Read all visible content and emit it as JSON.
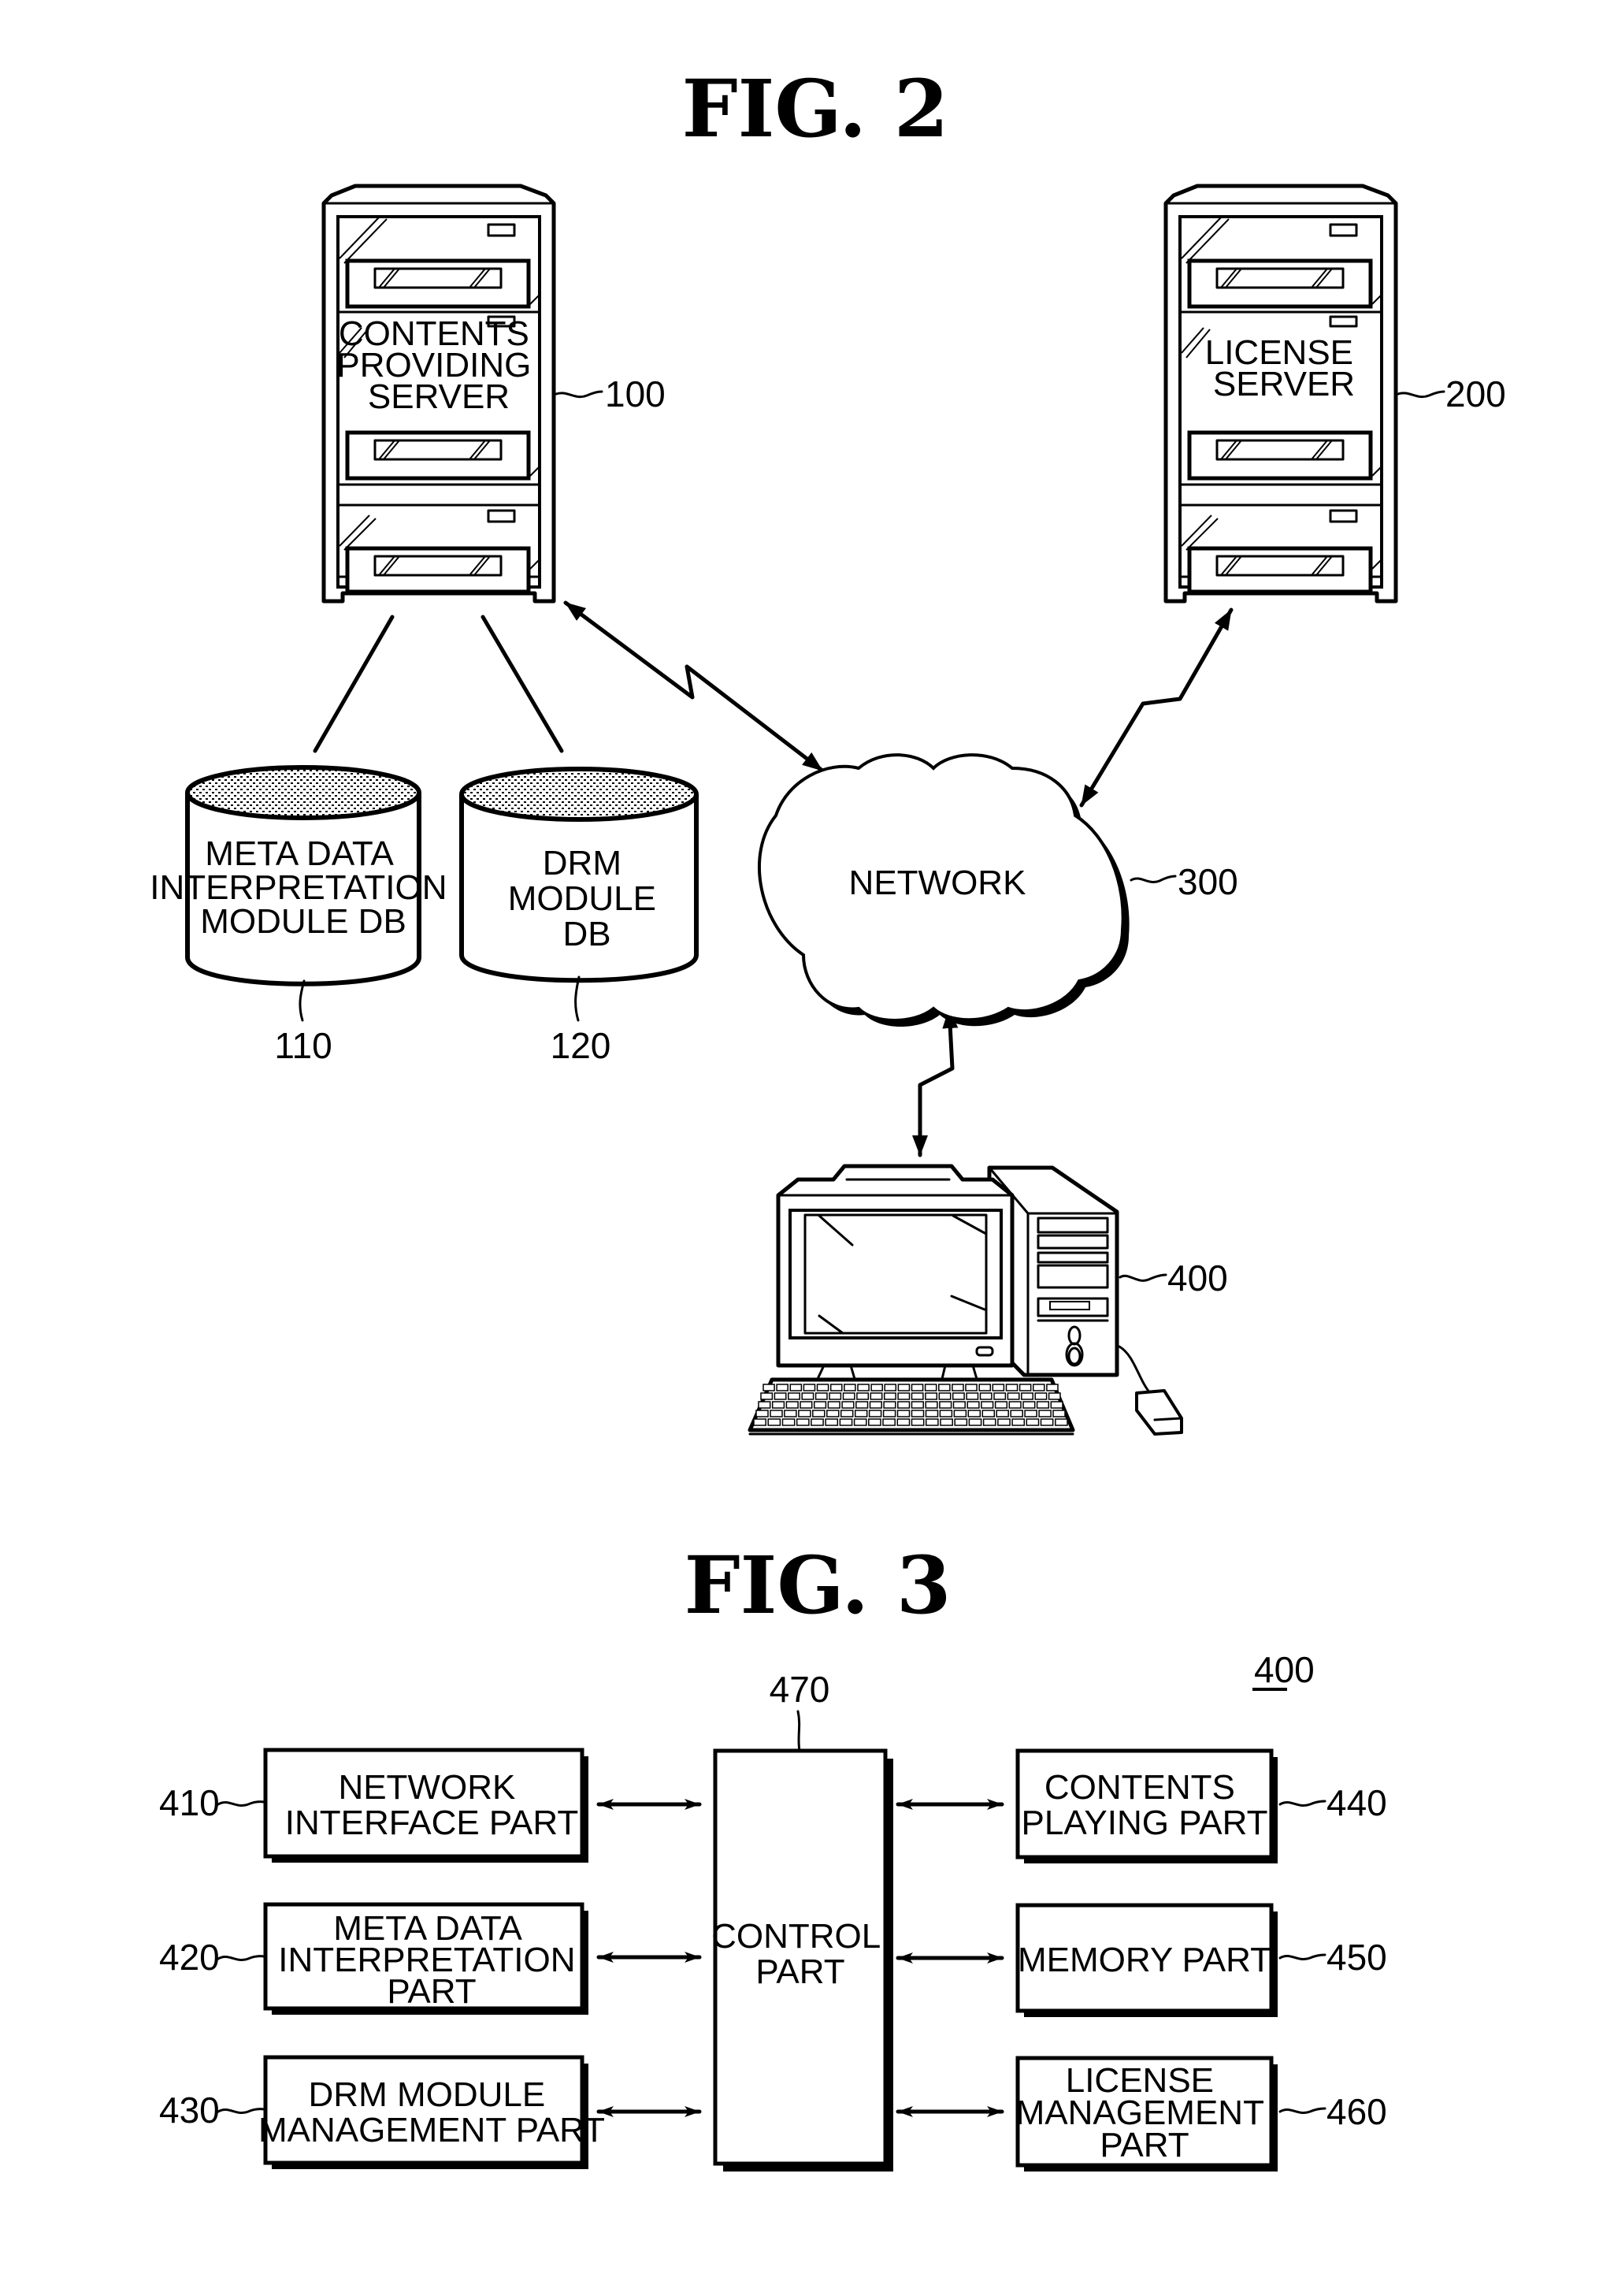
{
  "figure2": {
    "title": "FIG. 2",
    "contents_server": {
      "lines": [
        "CONTENTS",
        "PROVIDING",
        "SERVER"
      ],
      "ref": "100"
    },
    "license_server": {
      "lines": [
        "LICENSE",
        "SERVER"
      ],
      "ref": "200"
    },
    "meta_db": {
      "lines": [
        "META DATA",
        "INTERPRETATION",
        "MODULE DB"
      ],
      "ref": "110"
    },
    "drm_db": {
      "lines": [
        "DRM",
        "MODULE",
        "DB"
      ],
      "ref": "120"
    },
    "network": {
      "label": "NETWORK",
      "ref": "300"
    },
    "client": {
      "ref": "400"
    }
  },
  "figure3": {
    "title": "FIG. 3",
    "device_ref": "400",
    "control": {
      "lines": [
        "CONTROL",
        "PART"
      ],
      "ref": "470"
    },
    "left_blocks": [
      {
        "lines": [
          "NETWORK",
          "INTERFACE PART"
        ],
        "ref": "410"
      },
      {
        "lines": [
          "META DATA",
          "INTERPRETATION",
          "PART"
        ],
        "ref": "420"
      },
      {
        "lines": [
          "DRM MODULE",
          "MANAGEMENT PART"
        ],
        "ref": "430"
      }
    ],
    "right_blocks": [
      {
        "lines": [
          "CONTENTS",
          "PLAYING PART"
        ],
        "ref": "440"
      },
      {
        "lines": [
          "MEMORY PART"
        ],
        "ref": "450"
      },
      {
        "lines": [
          "LICENSE",
          "MANAGEMENT",
          "PART"
        ],
        "ref": "460"
      }
    ]
  }
}
